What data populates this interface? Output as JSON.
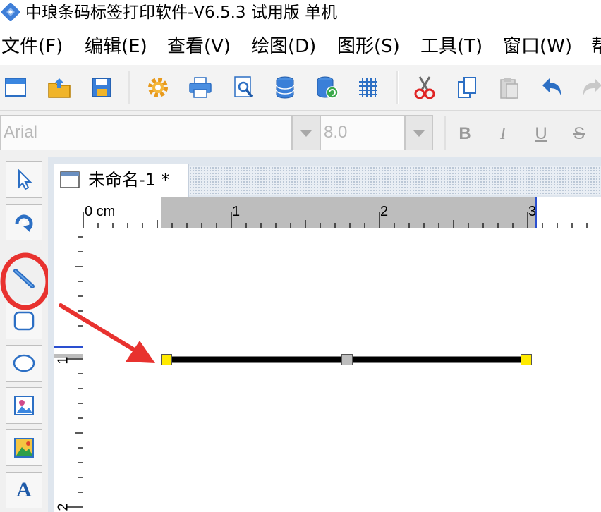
{
  "window": {
    "title": "中琅条码标签打印软件-V6.5.3 试用版 单机"
  },
  "menu": {
    "items": [
      {
        "id": "file",
        "label": "文件(F)"
      },
      {
        "id": "edit",
        "label": "编辑(E)"
      },
      {
        "id": "view",
        "label": "查看(V)"
      },
      {
        "id": "draw",
        "label": "绘图(D)"
      },
      {
        "id": "shape",
        "label": "图形(S)"
      },
      {
        "id": "tools",
        "label": "工具(T)"
      },
      {
        "id": "window",
        "label": "窗口(W)"
      },
      {
        "id": "help",
        "label": "帮"
      }
    ]
  },
  "toolbar": {
    "icons": [
      "new-document-icon",
      "open-folder-icon",
      "save-icon",
      "settings-gear-icon",
      "print-icon",
      "print-preview-icon",
      "database-icon",
      "database-refresh-icon",
      "grid-icon",
      "cut-icon",
      "copy-icon",
      "paste-icon",
      "undo-icon",
      "redo-icon"
    ]
  },
  "format": {
    "font_name": "Arial",
    "font_size": "8.0",
    "bold": "B",
    "italic": "I",
    "underline": "U",
    "strike": "S"
  },
  "tools": {
    "icons": [
      "select-arrow-icon",
      "rotate-icon",
      "line-tool-icon",
      "rounded-rectangle-icon",
      "ellipse-icon",
      "image-icon",
      "picture-icon",
      "text-tool-icon"
    ],
    "text_glyph": "A"
  },
  "document": {
    "tab_title": "未命名-1 *",
    "ruler_unit_label": "0 cm",
    "ruler_h_labels": [
      "1",
      "2",
      "3"
    ],
    "ruler_v_labels": [
      "1",
      "2"
    ]
  },
  "colors": {
    "highlight_red": "#e8322f",
    "handle_yellow": "#ffea00",
    "handle_gray": "#bdbdbd",
    "line_black": "#000000",
    "ruler_margin_gray": "#bdbdbd"
  }
}
